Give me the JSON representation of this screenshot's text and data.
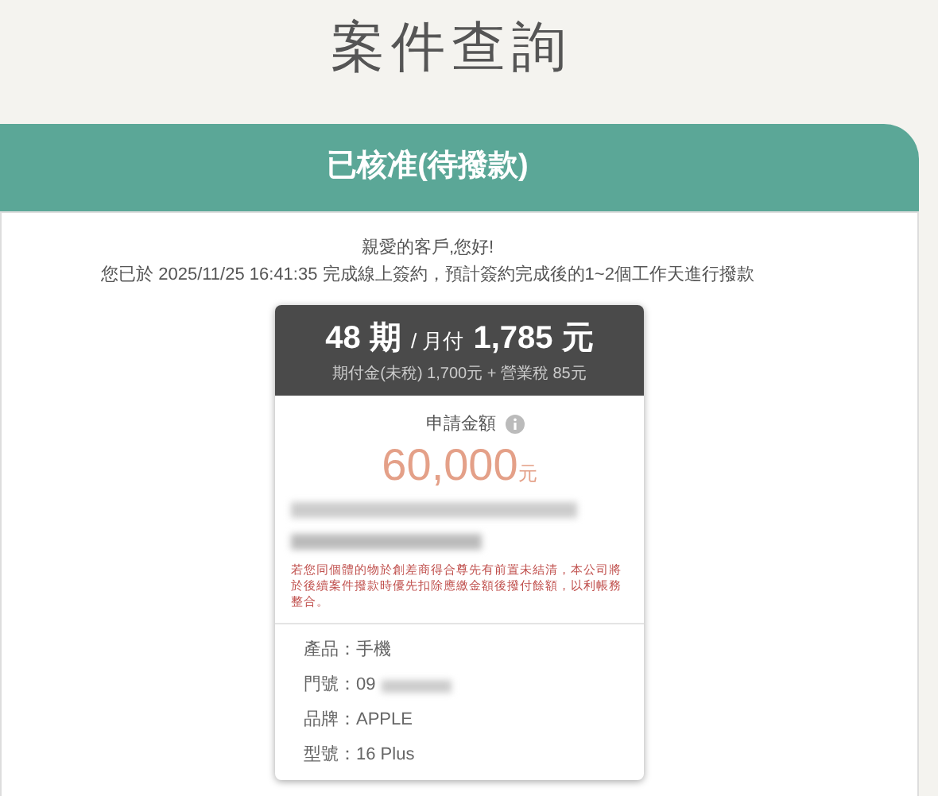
{
  "page_title": "案件查詢",
  "status": "已核准(待撥款)",
  "greeting": "親愛的客戶,您好!",
  "message": "您已於 2025/11/25 16:41:35 完成線上簽約，預計簽約完成後的1~2個工作天進行撥款",
  "plan": {
    "periods": "48 期",
    "separator": "/ 月付",
    "monthly": "1,785 元",
    "detail": "期付金(未稅) 1,700元 + 營業稅 85元"
  },
  "amount": {
    "label": "申請金額",
    "value": "60,000",
    "unit": "元"
  },
  "notice": "若您同個體的物於創差商得合尊先有前置未結清，本公司將於後續案件撥款時優先扣除應繳金額後撥付餘額，以利帳務整合。",
  "details": [
    {
      "label": "產品：",
      "value": "手機"
    },
    {
      "label": "門號：",
      "value": "09",
      "redacted": true
    },
    {
      "label": "品牌：",
      "value": "APPLE"
    },
    {
      "label": "型號：",
      "value": "16 Plus"
    }
  ]
}
